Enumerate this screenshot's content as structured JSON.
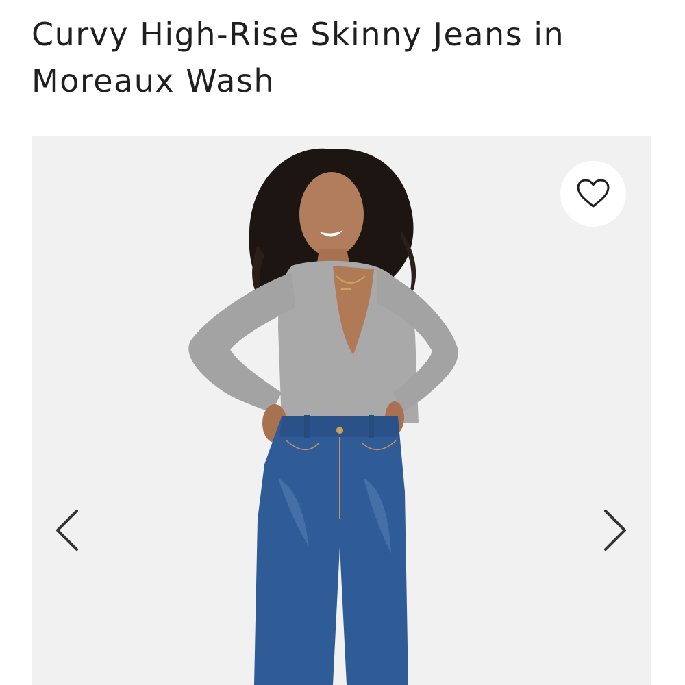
{
  "product": {
    "title": "Curvy High-Rise Skinny Jeans in Moreaux Wash"
  },
  "gallery": {
    "image_description_icon": "model-photo",
    "wishlist_icon": "heart-outline-icon",
    "prev_icon": "chevron-left-icon",
    "next_icon": "chevron-right-icon"
  },
  "colors": {
    "title_text": "#1f1f1f",
    "gallery_bg": "#f1f1f1",
    "icon_stroke": "#333333",
    "denim": "#2f5c97",
    "sweater": "#a9a9a9"
  }
}
